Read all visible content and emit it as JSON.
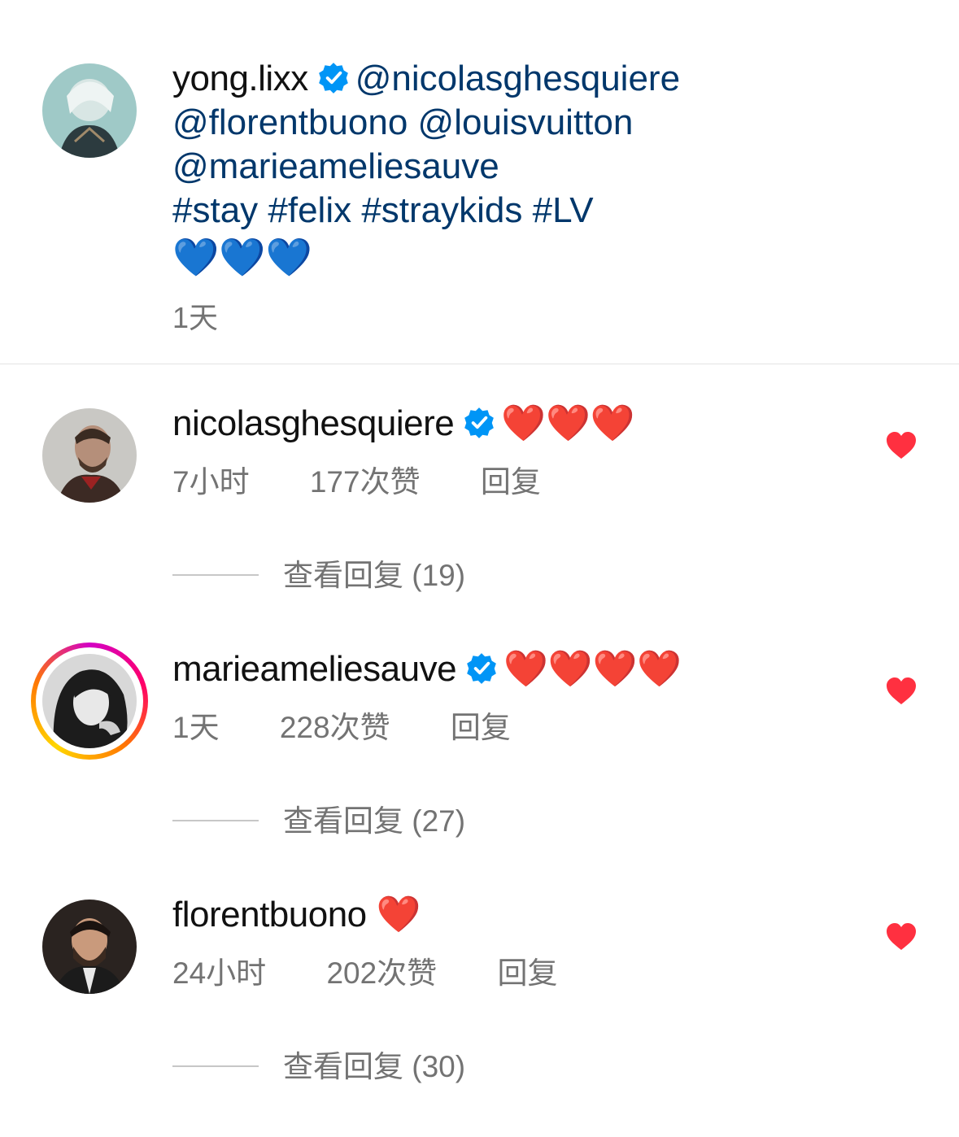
{
  "caption": {
    "username": "yong.lixx",
    "verified": true,
    "mentions": [
      "@nicolasghesquiere",
      "@florentbuono",
      "@louisvuitton",
      "@marieameliesauve"
    ],
    "hashtags": "#stay #felix #straykids #LV",
    "emoji": "💙💙💙",
    "time": "1天"
  },
  "comments": [
    {
      "username": "nicolasghesquiere",
      "verified": true,
      "text": "❤️❤️❤️",
      "time": "7小时",
      "likes": "177次赞",
      "reply": "回复",
      "view_replies": "查看回复 (19)"
    },
    {
      "username": "marieameliesauve",
      "verified": true,
      "text": "❤️❤️❤️❤️",
      "time": "1天",
      "likes": "228次赞",
      "reply": "回复",
      "view_replies": "查看回复 (27)"
    },
    {
      "username": "florentbuono",
      "verified": false,
      "text": "❤️",
      "time": "24小时",
      "likes": "202次赞",
      "reply": "回复",
      "view_replies": "查看回复 (30)"
    }
  ],
  "colors": {
    "link": "#00376b",
    "verified": "#0095f6",
    "muted": "#737373",
    "like_heart": "#ff3040"
  },
  "icons": [
    "verified-badge-icon",
    "like-heart-icon"
  ]
}
